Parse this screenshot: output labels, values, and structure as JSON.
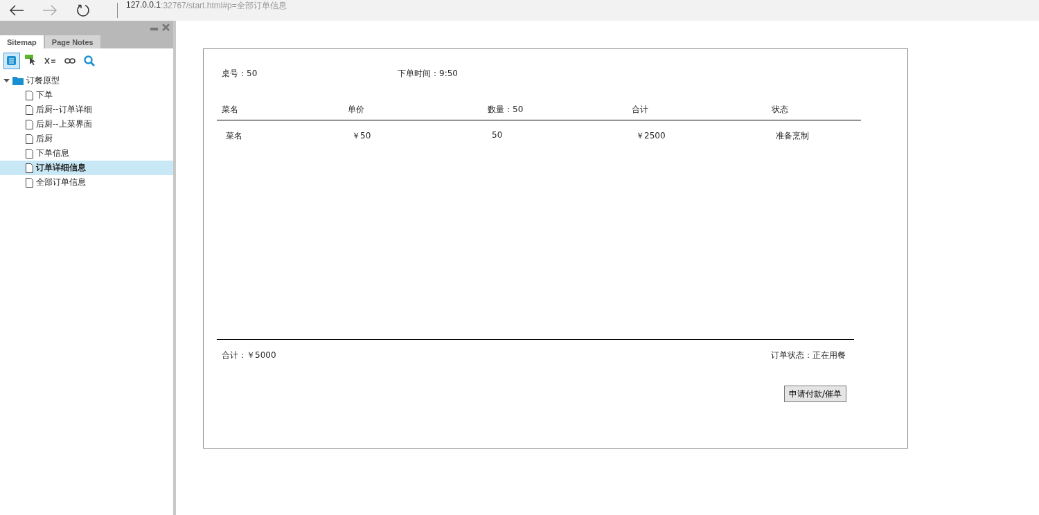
{
  "browser": {
    "host": "127.0.0.1",
    "path": ":32767/start.html#p=全部订单信息"
  },
  "sidebar": {
    "tabs": [
      {
        "label": "Sitemap",
        "selected": true
      },
      {
        "label": "Page Notes",
        "selected": false
      }
    ],
    "tree": [
      {
        "label": "订餐原型",
        "expanded": true,
        "children": [
          {
            "label": "下单",
            "selected": false
          },
          {
            "label": "后厨--订单详细",
            "selected": false
          },
          {
            "label": "后厨--上菜界面",
            "selected": false
          },
          {
            "label": "后厨",
            "selected": false
          },
          {
            "label": "下单信息",
            "selected": false
          },
          {
            "label": "订单详细信息",
            "selected": true
          },
          {
            "label": "全部订单信息",
            "selected": false
          }
        ]
      }
    ]
  },
  "order": {
    "table_no": "桌号：50",
    "order_time": "下单时间：9:50",
    "columns": [
      "菜名",
      "单价",
      "数量：50",
      "合计",
      "状态"
    ],
    "rows": [
      [
        "菜名",
        "￥50",
        "50",
        "￥2500",
        "准备烹制"
      ]
    ],
    "total": "合计：￥5000",
    "status": "订单状态：正在用餐",
    "button": "申请付款/催单"
  }
}
